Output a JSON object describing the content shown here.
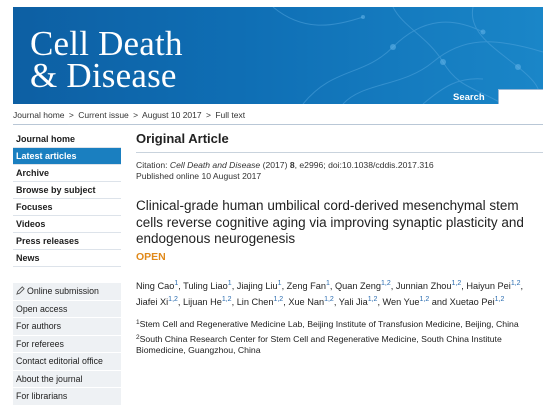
{
  "header": {
    "brand_line1": "Cell Death",
    "brand_line2": "& Disease",
    "search_label": "Search",
    "search_placeholder": "",
    "colors": {
      "banner": "#0f6fb5",
      "active_nav": "#1a7fc0",
      "open_access": "#e0891a"
    }
  },
  "breadcrumb": [
    "Journal home",
    "Current issue",
    "August 10 2017",
    "Full text"
  ],
  "breadcrumb_sep": ">",
  "sidebar": {
    "primary": [
      {
        "label": "Journal home"
      },
      {
        "label": "Latest articles",
        "active": true
      },
      {
        "label": "Archive"
      },
      {
        "label": "Browse by subject"
      },
      {
        "label": "Focuses"
      },
      {
        "label": "Videos"
      },
      {
        "label": "Press releases"
      },
      {
        "label": "News"
      }
    ],
    "secondary": [
      {
        "label": "Online submission",
        "icon": "pencil-icon"
      },
      {
        "label": "Open access"
      },
      {
        "label": "For authors"
      },
      {
        "label": "For referees"
      },
      {
        "label": "Contact editorial office"
      },
      {
        "label": "About the journal"
      },
      {
        "label": "For librarians"
      }
    ]
  },
  "article": {
    "section": "Original Article",
    "citation_prefix": "Citation: ",
    "journal": "Cell Death and Disease",
    "year": " (2017) ",
    "volume": "8",
    "cite_rest": ", e2996; doi:10.1038/cddis.2017.316",
    "published": "Published online 10 August 2017",
    "title": "Clinical-grade human umbilical cord-derived mesenchymal stem cells reverse cognitive aging via improving synaptic plasticity and endogenous neurogenesis",
    "access": "OPEN",
    "authors": [
      {
        "name": "Ning Cao",
        "aff": "1"
      },
      {
        "name": "Tuling Liao",
        "aff": "1"
      },
      {
        "name": "Jiajing Liu",
        "aff": "1"
      },
      {
        "name": "Zeng Fan",
        "aff": "1"
      },
      {
        "name": "Quan Zeng",
        "aff": "1,2"
      },
      {
        "name": "Junnian Zhou",
        "aff": "1,2"
      },
      {
        "name": "Haiyun Pei",
        "aff": "1,2"
      },
      {
        "name": "Jiafei Xi",
        "aff": "1,2"
      },
      {
        "name": "Lijuan He",
        "aff": "1,2"
      },
      {
        "name": "Lin Chen",
        "aff": "1,2"
      },
      {
        "name": "Xue Nan",
        "aff": "1,2"
      },
      {
        "name": "Yali Jia",
        "aff": "1,2"
      },
      {
        "name": "Wen Yue",
        "aff": "1,2"
      },
      {
        "name": "Xuetao Pei",
        "aff": "1,2"
      }
    ],
    "affiliations": [
      {
        "num": "1",
        "text": "Stem Cell and Regenerative Medicine Lab, Beijing Institute of Transfusion Medicine, Beijing, China"
      },
      {
        "num": "2",
        "text": "South China Research Center for Stem Cell and Regenerative Medicine, South China Institute Biomedicine, Guangzhou, China"
      }
    ]
  }
}
